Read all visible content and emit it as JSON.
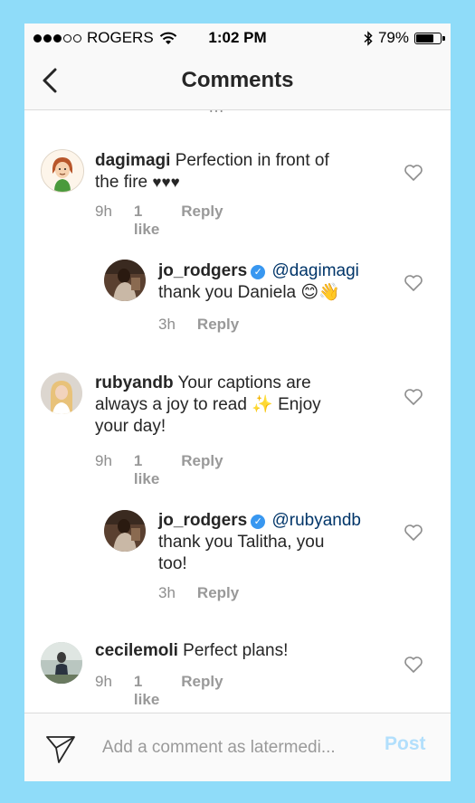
{
  "status_bar": {
    "carrier": "ROGERS",
    "time": "1:02 PM",
    "battery": "79%",
    "battery_level": 0.79,
    "signal_bars_filled": 3,
    "signal_bars_total": 5,
    "icons": [
      "signal-dots-icon",
      "wifi-icon",
      "bluetooth-icon",
      "battery-icon"
    ]
  },
  "nav": {
    "title": "Comments",
    "back_icon": "chevron-left-icon"
  },
  "comments": [
    {
      "username": "dagimagi",
      "text_line1": "Perfection in front of",
      "text_line2": "the fire",
      "suffix": "♥♥♥",
      "time": "9h",
      "likes": "1 like",
      "reply": "Reply",
      "avatar_icon": "cartoon-avatar"
    },
    {
      "username": "jo_rodgers",
      "verified": true,
      "mention": "@dagimagi",
      "text_line1": "thank you Daniela 😊👋",
      "time": "3h",
      "reply": "Reply",
      "is_reply": true
    },
    {
      "username": "rubyandb",
      "text_line1": "Your captions are",
      "text_line2": "always a joy to read ✨  Enjoy",
      "text_line3": "your day!",
      "time": "9h",
      "likes": "1 like",
      "reply": "Reply"
    },
    {
      "username": "jo_rodgers",
      "verified": true,
      "mention": "@rubyandb",
      "text_line1": "thank you Talitha, you",
      "text_line2": "too!",
      "time": "3h",
      "reply": "Reply",
      "is_reply": true
    },
    {
      "username": "cecilemoli",
      "text_line1": "Perfect plans!",
      "time": "9h",
      "likes": "1 like",
      "reply": "Reply"
    }
  ],
  "composer": {
    "placeholder": "Add a comment as latermedi...",
    "post_label": "Post",
    "send_icon": "paper-plane-icon"
  },
  "colors": {
    "background_frame": "#8fdcf9",
    "username": "#262626",
    "mention": "#003569",
    "meta": "#8e8e8e",
    "verified": "#3897f0",
    "post_disabled": "#b2dffc"
  }
}
